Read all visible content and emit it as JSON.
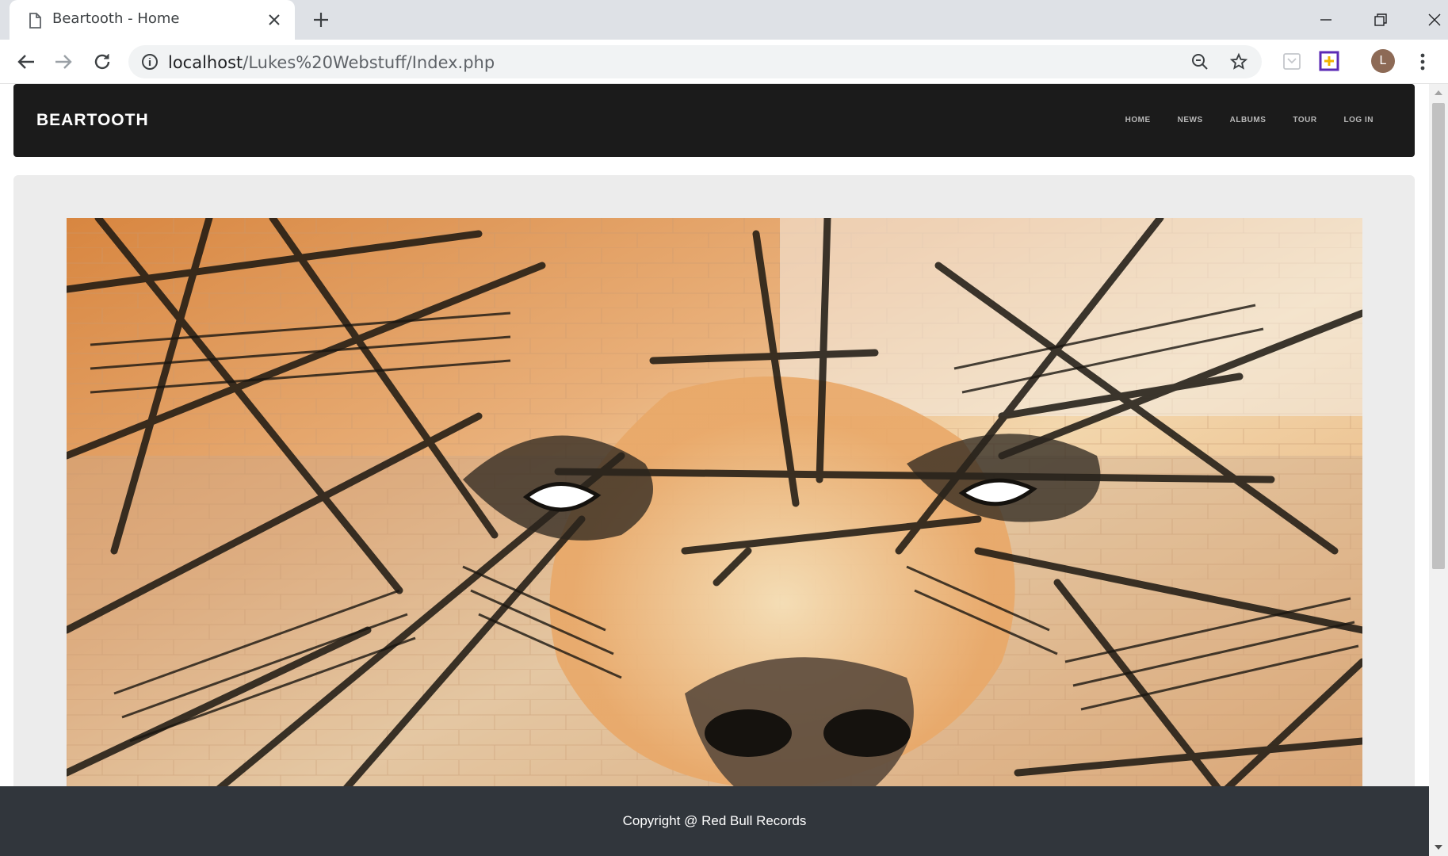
{
  "browser": {
    "tab_title": "Beartooth - Home",
    "url_host": "localhost",
    "url_path": "/Lukes%20Webstuff/Index.php",
    "avatar_letter": "L"
  },
  "site": {
    "brand": "BEARTOOTH",
    "nav": [
      "HOME",
      "NEWS",
      "ALBUMS",
      "TOUR",
      "LOG IN"
    ],
    "footer": "Copyright @ Red Bull Records",
    "hero_image": "bear-graffiti-mural"
  },
  "colors": {
    "navbar": "#1b1b1b",
    "jumbotron": "#ececec",
    "footer": "#31363c"
  }
}
